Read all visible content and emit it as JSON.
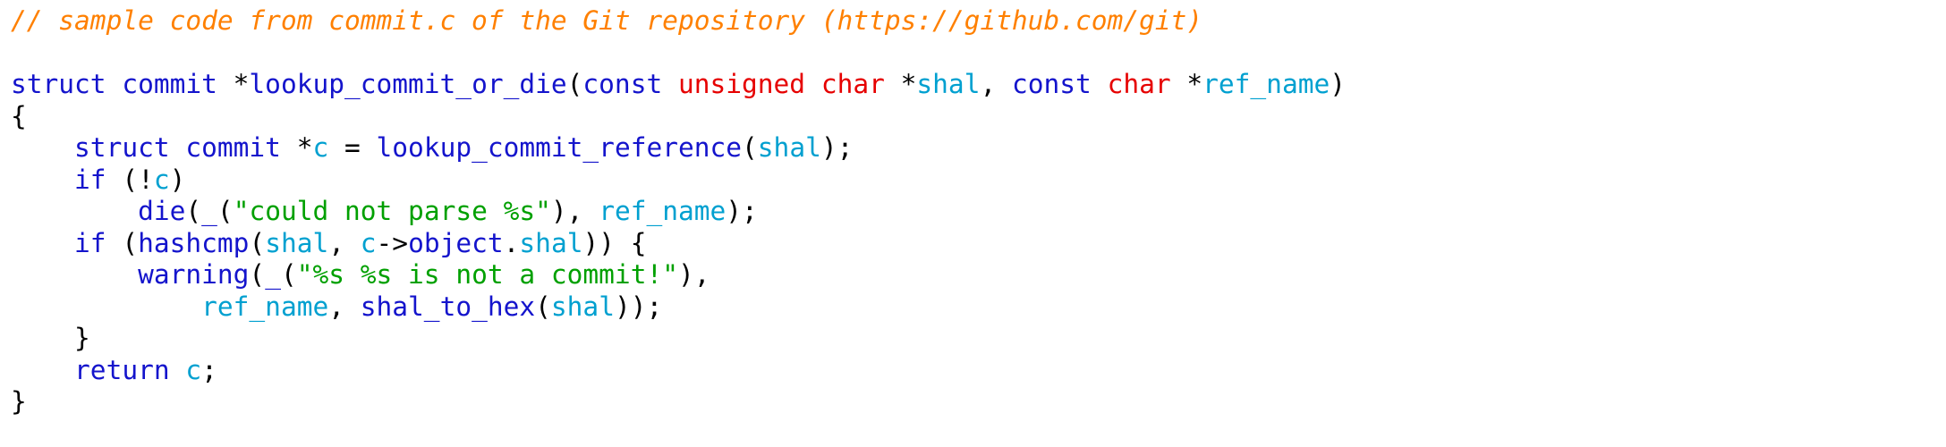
{
  "palette": {
    "background": "#ffffff",
    "plain": "#000000",
    "keyword": "#1414cc",
    "type": "#e60000",
    "identifier": "#00a0d0",
    "string": "#00a000",
    "comment": "#ff8000",
    "function": "#1414cc"
  },
  "editor": {
    "language": "c",
    "font_size_px": 29.5
  },
  "code": {
    "lines": [
      {
        "id": "line-1-comment",
        "text": "// sample code from commit.c of the Git repository (https://github.com/git)",
        "tokens": [
          {
            "text": "// sample code from commit.c of the Git repository (https://github.com/git)",
            "color": "comment",
            "italic": true
          }
        ]
      },
      {
        "id": "line-2-blank",
        "text": "",
        "tokens": []
      },
      {
        "id": "line-3-signature",
        "text": "struct commit *lookup_commit_or_die(const unsigned char *shal, const char *ref_name)",
        "tokens": [
          {
            "text": "struct commit ",
            "color": "keyword"
          },
          {
            "text": "*",
            "color": "plain"
          },
          {
            "text": "lookup_commit_or_die",
            "color": "function"
          },
          {
            "text": "(",
            "color": "plain"
          },
          {
            "text": "const ",
            "color": "keyword"
          },
          {
            "text": "unsigned char ",
            "color": "type"
          },
          {
            "text": "*",
            "color": "plain"
          },
          {
            "text": "shal",
            "color": "identifier"
          },
          {
            "text": ", ",
            "color": "plain"
          },
          {
            "text": "const ",
            "color": "keyword"
          },
          {
            "text": "char ",
            "color": "type"
          },
          {
            "text": "*",
            "color": "plain"
          },
          {
            "text": "ref_name",
            "color": "identifier"
          },
          {
            "text": ")",
            "color": "plain"
          }
        ]
      },
      {
        "id": "line-4-open-brace",
        "text": "{",
        "tokens": [
          {
            "text": "{",
            "color": "plain"
          }
        ]
      },
      {
        "id": "line-5-declaration",
        "text": "    struct commit *c = lookup_commit_reference(shal);",
        "tokens": [
          {
            "text": "    ",
            "color": "plain"
          },
          {
            "text": "struct commit ",
            "color": "keyword"
          },
          {
            "text": "*",
            "color": "plain"
          },
          {
            "text": "c",
            "color": "identifier"
          },
          {
            "text": " = ",
            "color": "plain"
          },
          {
            "text": "lookup_commit_reference",
            "color": "function"
          },
          {
            "text": "(",
            "color": "plain"
          },
          {
            "text": "shal",
            "color": "identifier"
          },
          {
            "text": ");",
            "color": "plain"
          }
        ]
      },
      {
        "id": "line-6-if-not-c",
        "text": "    if (!c)",
        "tokens": [
          {
            "text": "    ",
            "color": "plain"
          },
          {
            "text": "if",
            "color": "keyword"
          },
          {
            "text": " (!",
            "color": "plain"
          },
          {
            "text": "c",
            "color": "identifier"
          },
          {
            "text": ")",
            "color": "plain"
          }
        ]
      },
      {
        "id": "line-7-die",
        "text": "        die(_(\"could not parse %s\"), ref_name);",
        "tokens": [
          {
            "text": "        ",
            "color": "plain"
          },
          {
            "text": "die",
            "color": "function"
          },
          {
            "text": "(",
            "color": "plain"
          },
          {
            "text": "_",
            "color": "function"
          },
          {
            "text": "(",
            "color": "plain"
          },
          {
            "text": "\"could not parse %s\"",
            "color": "string"
          },
          {
            "text": "), ",
            "color": "plain"
          },
          {
            "text": "ref_name",
            "color": "identifier"
          },
          {
            "text": ");",
            "color": "plain"
          }
        ]
      },
      {
        "id": "line-8-if-hashcmp",
        "text": "    if (hashcmp(shal, c->object.shal)) {",
        "tokens": [
          {
            "text": "    ",
            "color": "plain"
          },
          {
            "text": "if",
            "color": "keyword"
          },
          {
            "text": " (",
            "color": "plain"
          },
          {
            "text": "hashcmp",
            "color": "function"
          },
          {
            "text": "(",
            "color": "plain"
          },
          {
            "text": "shal",
            "color": "identifier"
          },
          {
            "text": ", ",
            "color": "plain"
          },
          {
            "text": "c",
            "color": "identifier"
          },
          {
            "text": "->",
            "color": "plain"
          },
          {
            "text": "object",
            "color": "keyword"
          },
          {
            "text": ".",
            "color": "plain"
          },
          {
            "text": "shal",
            "color": "identifier"
          },
          {
            "text": ")) {",
            "color": "plain"
          }
        ]
      },
      {
        "id": "line-9-warning",
        "text": "        warning(_(\"%s %s is not a commit!\"),",
        "tokens": [
          {
            "text": "        ",
            "color": "plain"
          },
          {
            "text": "warning",
            "color": "function"
          },
          {
            "text": "(",
            "color": "plain"
          },
          {
            "text": "_",
            "color": "function"
          },
          {
            "text": "(",
            "color": "plain"
          },
          {
            "text": "\"%s %s is not a commit!\"",
            "color": "string"
          },
          {
            "text": "),",
            "color": "plain"
          }
        ]
      },
      {
        "id": "line-10-warning-args",
        "text": "            ref_name, shal_to_hex(shal));",
        "tokens": [
          {
            "text": "            ",
            "color": "plain"
          },
          {
            "text": "ref_name",
            "color": "identifier"
          },
          {
            "text": ", ",
            "color": "plain"
          },
          {
            "text": "shal_to_hex",
            "color": "function"
          },
          {
            "text": "(",
            "color": "plain"
          },
          {
            "text": "shal",
            "color": "identifier"
          },
          {
            "text": "));",
            "color": "plain"
          }
        ]
      },
      {
        "id": "line-11-close-if",
        "text": "    }",
        "tokens": [
          {
            "text": "    }",
            "color": "plain"
          }
        ]
      },
      {
        "id": "line-12-return",
        "text": "    return c;",
        "tokens": [
          {
            "text": "    ",
            "color": "plain"
          },
          {
            "text": "return",
            "color": "keyword"
          },
          {
            "text": " ",
            "color": "plain"
          },
          {
            "text": "c",
            "color": "identifier"
          },
          {
            "text": ";",
            "color": "plain"
          }
        ]
      },
      {
        "id": "line-13-close-brace",
        "text": "}",
        "tokens": [
          {
            "text": "}",
            "color": "plain"
          }
        ]
      }
    ]
  }
}
